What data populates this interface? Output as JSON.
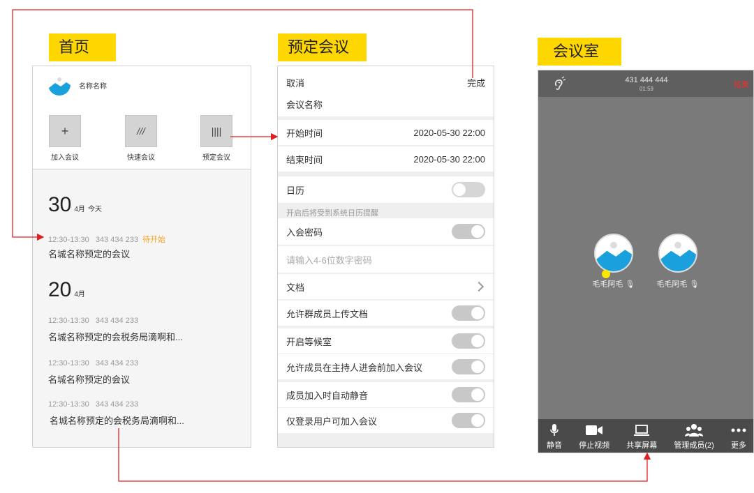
{
  "labels": {
    "home": "首页",
    "schedule": "预定会议",
    "room": "会议室"
  },
  "home": {
    "username": "名称名称",
    "actions": [
      {
        "icon": "+",
        "label": "加入会议"
      },
      {
        "icon": "///",
        "label": "快速会议"
      },
      {
        "icon": "||||",
        "label": "预定会议"
      }
    ],
    "day1": {
      "day": "30",
      "month": "4月",
      "today": "今天"
    },
    "meet1": {
      "time": "12:30-13:30",
      "number": "343 434 233",
      "status": "待开始",
      "title": "名城名称预定的会议"
    },
    "day2": {
      "day": "20",
      "month": "4月"
    },
    "meet2": {
      "time": "12:30-13:30",
      "number": "343 434 233",
      "title": "名城名称预定的会税务局滴啊和..."
    },
    "meet3": {
      "time": "12:30-13:30",
      "number": "343 434 233",
      "title": "名城名称预定的会议"
    },
    "meet4": {
      "time": "12:30-13:30",
      "number": "343 434 233",
      "title": "名城名称预定的会税务局滴啊和..."
    }
  },
  "schedule": {
    "cancel": "取消",
    "done": "完成",
    "name_label": "会议名称",
    "start_label": "开始时间",
    "start_value": "2020-05-30   22:00",
    "end_label": "结束时间",
    "end_value": "2020-05-30   22:00",
    "calendar_label": "日历",
    "calendar_hint": "开启后将受到系统日历提醒",
    "password_label": "入会密码",
    "password_placeholder": "请输入4-6位数字密码",
    "docs_label": "文档",
    "allow_upload_label": "允许群成员上传文档",
    "waiting_room_label": "开启等候室",
    "join_before_host_label": "允许成员在主持人进会前加入会议",
    "auto_mute_label": "成员加入时自动静音",
    "login_only_label": "仅登录用户可加入会议"
  },
  "room": {
    "meeting_number": "431 444 444",
    "elapsed": "01:59",
    "end": "结束",
    "members": [
      {
        "name": "毛毛阿毛"
      },
      {
        "name": "毛毛阿毛"
      }
    ],
    "toolbar": {
      "mute": "静音",
      "stop_video": "停止视频",
      "share_screen": "共享屏幕",
      "manage_members": "管理成员(2)",
      "more": "更多"
    }
  },
  "colors": {
    "accent_yellow": "#ffd700",
    "connector_red": "#e02020",
    "pending_orange": "#f5a623",
    "end_red": "#ff2a2a"
  }
}
